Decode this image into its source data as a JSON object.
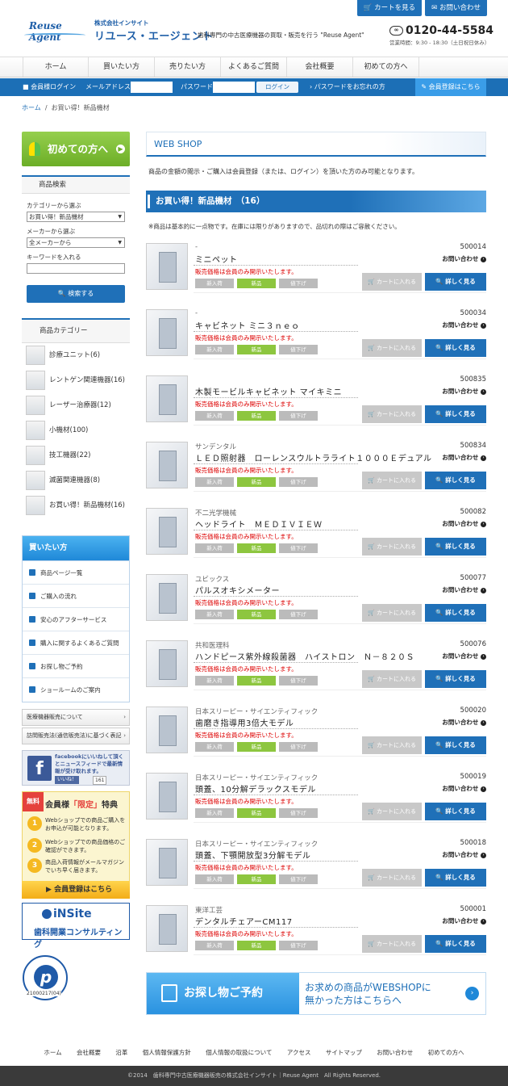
{
  "header": {
    "cart_btn": "カートを見る",
    "contact_btn": "お問い合わせ",
    "logo_text": "Reuse Agent",
    "company_small": "株式会社インサイト",
    "company_big": "リユース・エージェント",
    "catch": "歯科専門の中古医療機器の買取・販売を行う \"Reuse Agent\"",
    "tel": "0120-44-5584",
    "tel_icon": "フリーダイヤル",
    "hours": "営業時間：9:30 - 18:30（土日祝日休み）"
  },
  "gnav": [
    "ホーム",
    "買いたい方",
    "売りたい方",
    "よくあるご質問",
    "会社概要",
    "初めての方へ"
  ],
  "login": {
    "member_login": "会員様ログイン",
    "mail_label": "メールアドレス",
    "pass_label": "パスワード",
    "login_btn": "ログイン",
    "forgot": "パスワードをお忘れの方",
    "register": "会員登録はこちら"
  },
  "breadcrumb": {
    "home": "ホーム",
    "sep": "/",
    "current": "お買い得！新品機材"
  },
  "sidebar": {
    "hajimete": "初めての方へ",
    "search_title": "商品検索",
    "cat_label": "カテゴリーから選ぶ",
    "cat_value": "お買い得！新品機材",
    "maker_label": "メーカーから選ぶ",
    "maker_value": "全メーカーから",
    "keyword_label": "キーワードを入れる",
    "search_btn": "検索する",
    "category_title": "商品カテゴリー",
    "categories": [
      "診療ユニット(6)",
      "レントゲン関連機器(16)",
      "レーザー治療器(12)",
      "小機材(100)",
      "技工機器(22)",
      "滅菌関連機器(8)",
      "お買い得！新品機材(16)"
    ],
    "buyer_title": "買いたい方",
    "buyer_items": [
      "商品ページ一覧",
      "ご購入の流れ",
      "安心のアフターサービス",
      "購入に関するよくあるご質問",
      "お探し物ご予約",
      "ショールームのご案内"
    ],
    "box1": "医療機器販売について",
    "box2": "訪問販売法(通信販売法)に基づく表記",
    "fb_text": "facebookにいいねして頂くとニュースフィードで最新情報が受け取れます。",
    "fb_like": "いいね！",
    "fb_count": "161",
    "muryo_tag": "無料",
    "muryo_title_a": "会員様",
    "muryo_title_b": "「限定」",
    "muryo_title_c": "特典",
    "muryo_items": [
      "Webショップでの商品ご購入をお申込が可能となります。",
      "Webショップでの商品価格のご確認ができます。",
      "商品入荷情報がメールマガジンでいち早く届きます。"
    ],
    "muryo_btn": "会員登録はこちら",
    "insite_a": "iNSite",
    "insite_b": "歯科開業コンサルティング",
    "privacy_num": "21000217(04)"
  },
  "main": {
    "webshop_title": "WEB SHOP",
    "notice": "商品の金額の閲示・ご購入は会員登録（または、ログイン）を頂いた方のみ可能となります。",
    "list_title": "お買い得！新品機材　（16）",
    "note": "※商品は基本的に一点物です。在庫には限りがありますので、品切れの際はご容赦ください。",
    "member_price": "販売価格は会員のみ開示いたします。",
    "tag_new_arrival": "新入荷",
    "tag_new": "新品",
    "tag_down": "値下げ",
    "cart": "カートに入れる",
    "detail": "詳しく見る",
    "inquiry": "お問い合わせ",
    "products": [
      {
        "maker": "-",
        "name": "ミニペット",
        "id": "500014"
      },
      {
        "maker": "-",
        "name": "キャビネット ミニ３ｎｅｏ",
        "id": "500034"
      },
      {
        "maker": "",
        "name": "木製モービルキャビネット マイキミニ",
        "id": "500835"
      },
      {
        "maker": "サンデンタル",
        "name": "ＬＥＤ照射器　ローレンスウルトラライト１０００Ｅデュアル",
        "id": "500834"
      },
      {
        "maker": "不二光学機械",
        "name": "ヘッドライト　ＭＥＤＩＶＩＥＷ",
        "id": "500082"
      },
      {
        "maker": "ユビックス",
        "name": "パルスオキシメーター",
        "id": "500077"
      },
      {
        "maker": "共和医理科",
        "name": "ハンドピース紫外線殺菌器　ハイストロン　Ｎ－８２０Ｓ",
        "id": "500076"
      },
      {
        "maker": "日本スリーピー・サイエンティフィック",
        "name": "歯磨き指導用3倍大モデル",
        "id": "500020"
      },
      {
        "maker": "日本スリーピー・サイエンティフィック",
        "name": "頭蓋、10分解デラックスモデル",
        "id": "500019"
      },
      {
        "maker": "日本スリーピー・サイエンティフィック",
        "name": "頭蓋、下顎開放型3分解モデル",
        "id": "500018"
      },
      {
        "maker": "東洋工芸",
        "name": "デンタルチェアーCM117",
        "id": "500001"
      }
    ],
    "osagashi_left": "お探し物ご予約",
    "osagashi_right1": "お求めの商品がWEBSHOPに",
    "osagashi_right2": "無かった方はこちらへ"
  },
  "footer": {
    "links": [
      "ホーム",
      "会社概要",
      "沿革",
      "個人情報保護方針",
      "個人情報の取扱について",
      "アクセス",
      "サイトマップ",
      "お問い合わせ",
      "初めての方へ"
    ],
    "copyright": "©2014　歯科専門中古医療機器販売の株式会社インサイト｜Reuse Agent　All Rights Reserved."
  }
}
